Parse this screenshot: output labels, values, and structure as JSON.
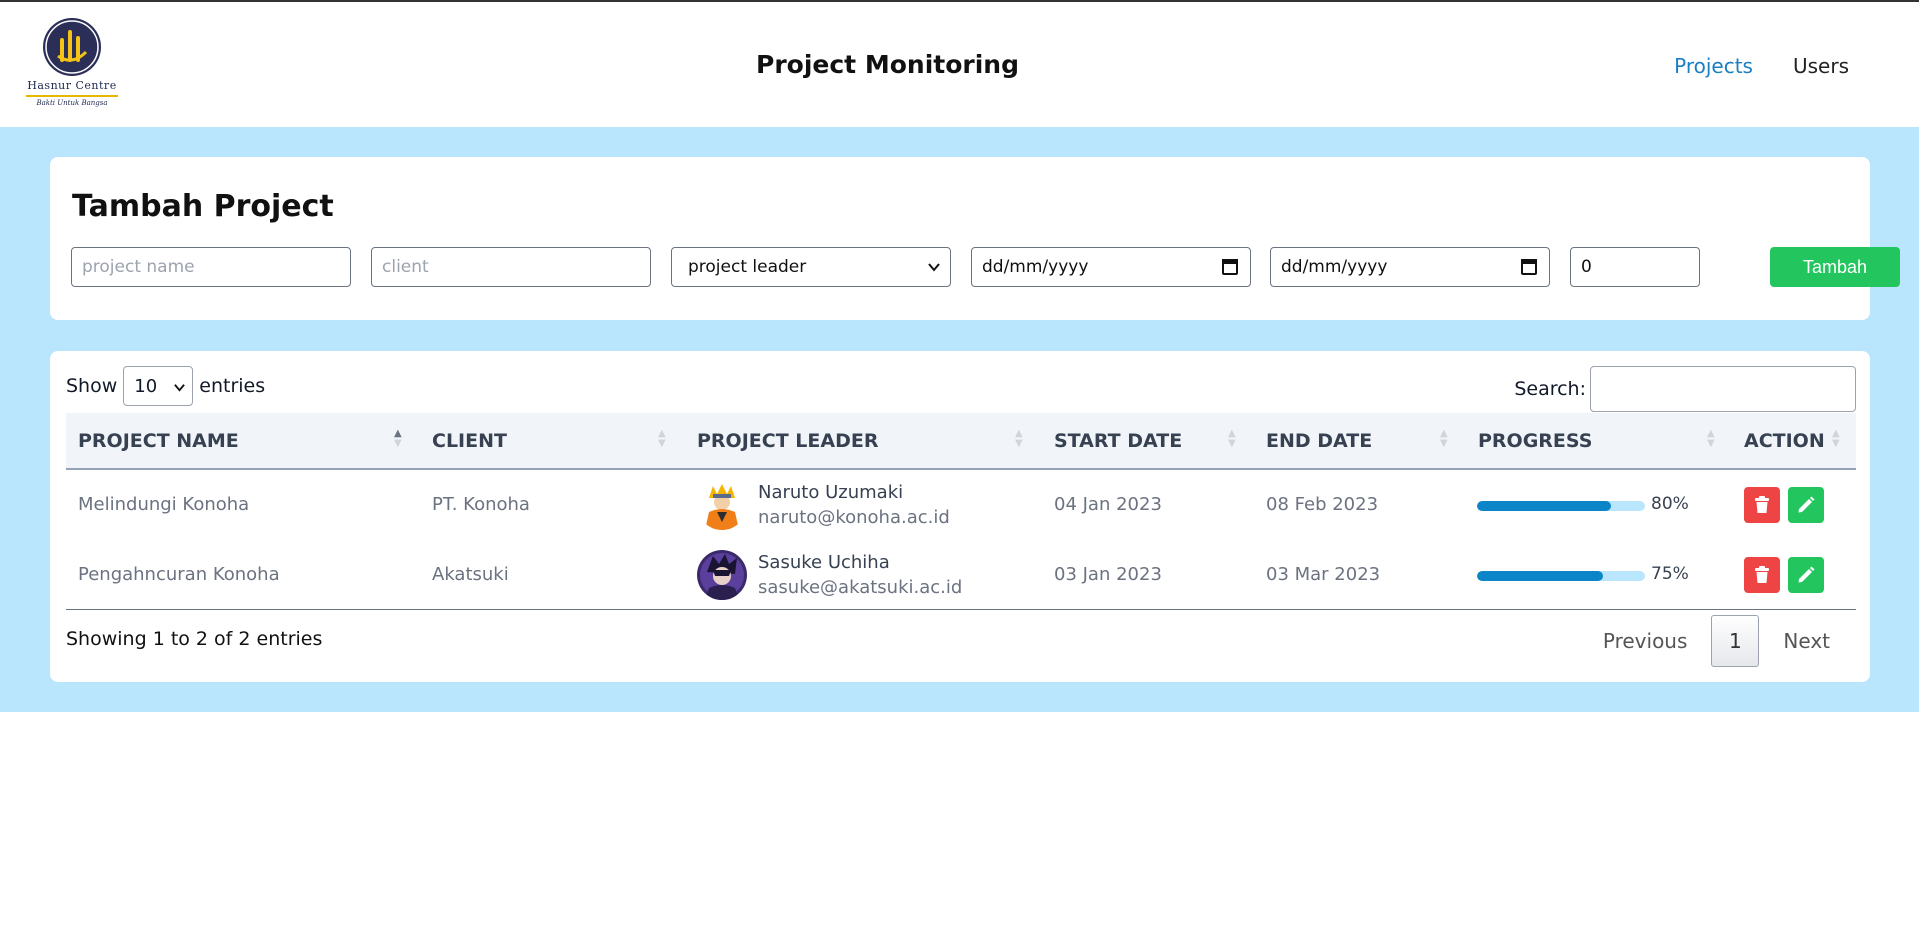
{
  "header": {
    "logo_name": "Hasnur Centre",
    "logo_tagline": "Bakti Untuk Bangsa",
    "title": "Project Monitoring",
    "nav": [
      {
        "label": "Projects",
        "active": true
      },
      {
        "label": "Users",
        "active": false
      }
    ]
  },
  "form": {
    "title": "Tambah Project",
    "project_name_placeholder": "project name",
    "client_placeholder": "client",
    "leader_select_value": "project leader",
    "start_date_placeholder": "dd/mm/yyyy",
    "end_date_placeholder": "dd/mm/yyyy",
    "progress_value": "0",
    "submit_label": "Tambah"
  },
  "table": {
    "show_label": "Show",
    "entries_value": "10",
    "entries_label": "entries",
    "search_label": "Search:",
    "columns": [
      "PROJECT NAME",
      "CLIENT",
      "PROJECT LEADER",
      "START DATE",
      "END DATE",
      "PROGRESS",
      "ACTION"
    ],
    "rows": [
      {
        "project_name": "Melindungi Konoha",
        "client": "PT. Konoha",
        "leader_name": "Naruto Uzumaki",
        "leader_email": "naruto@konoha.ac.id",
        "start_date": "04 Jan 2023",
        "end_date": "08 Feb 2023",
        "progress": 80,
        "progress_label": "80%"
      },
      {
        "project_name": "Pengahncuran Konoha",
        "client": "Akatsuki",
        "leader_name": "Sasuke Uchiha",
        "leader_email": "sasuke@akatsuki.ac.id",
        "start_date": "03 Jan 2023",
        "end_date": "03 Mar 2023",
        "progress": 75,
        "progress_label": "75%"
      }
    ],
    "info": "Showing 1 to 2 of 2 entries",
    "pagination": {
      "previous": "Previous",
      "current": "1",
      "next": "Next"
    }
  },
  "colors": {
    "accent": "#1b7fc4",
    "background": "#bae6fd",
    "success": "#22c55e",
    "danger": "#ef4444",
    "progress": "#0b85c8"
  },
  "icons": [
    "trash-icon",
    "pencil-icon",
    "calendar-icon",
    "chevron-down-icon",
    "sort-icon"
  ]
}
